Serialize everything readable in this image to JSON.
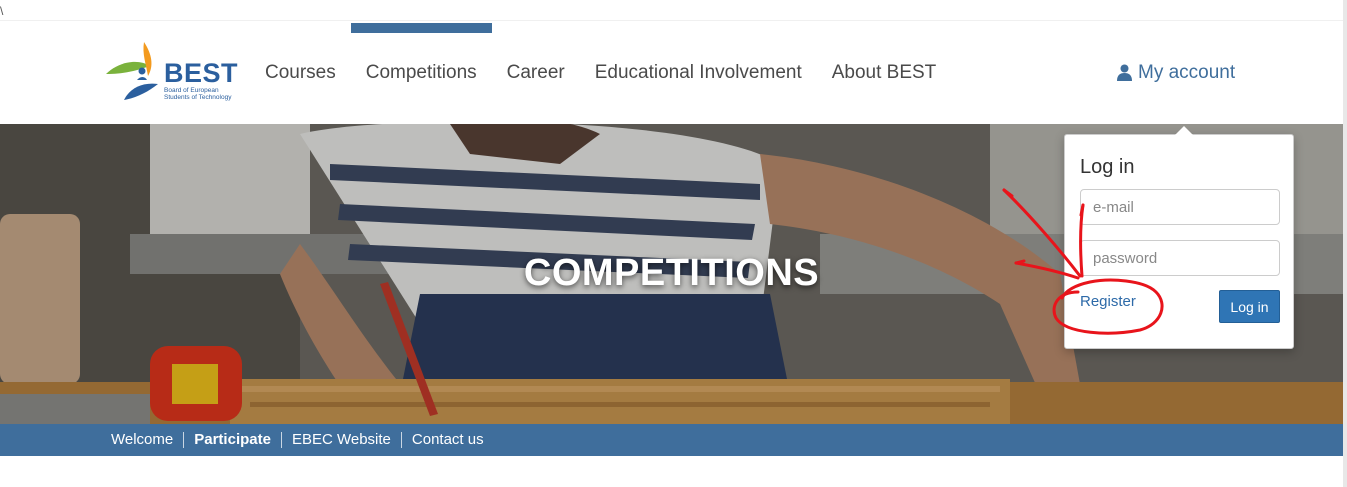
{
  "corner_mark": "\\",
  "logo": {
    "word": "BEST",
    "sub": "Board of European Students of Technology"
  },
  "nav": {
    "items": [
      {
        "label": "Courses"
      },
      {
        "label": "Competitions"
      },
      {
        "label": "Career"
      },
      {
        "label": "Educational Involvement"
      },
      {
        "label": "About BEST"
      }
    ],
    "active": "Competitions",
    "account_label": "My account"
  },
  "hero": {
    "title": "COMPETITIONS"
  },
  "subnav": {
    "items": [
      {
        "label": "Welcome"
      },
      {
        "label": "Participate"
      },
      {
        "label": "EBEC Website"
      },
      {
        "label": "Contact us"
      }
    ]
  },
  "login": {
    "title": "Log in",
    "email_placeholder": "e-mail",
    "password_placeholder": "password",
    "register_label": "Register",
    "submit_label": "Log in"
  },
  "colors": {
    "brand_blue": "#3f6e9c",
    "link_blue": "#2d6aa8",
    "button_blue": "#2f75b5",
    "annotation_red": "#e8141b"
  },
  "icons": {
    "account": "user-icon"
  }
}
